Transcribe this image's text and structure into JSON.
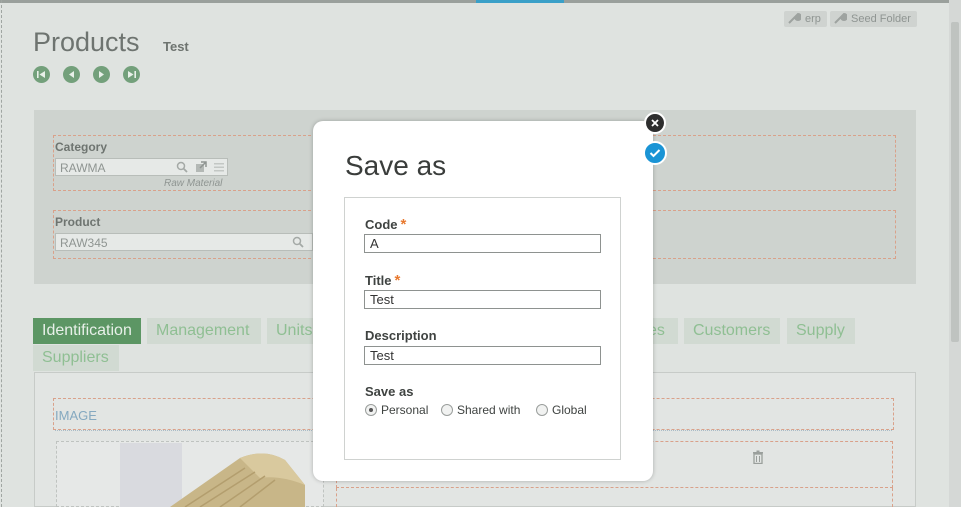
{
  "header": {
    "title": "Products",
    "subtitle": "Test",
    "erp_label": "erp",
    "seed_folder_label": "Seed Folder"
  },
  "form": {
    "category": {
      "label": "Category",
      "value": "RAWMA",
      "help": "Raw Material"
    },
    "product": {
      "label": "Product",
      "value": "RAW345"
    }
  },
  "tabs": {
    "identification": "Identification",
    "management": "Management",
    "units": "Units",
    "sales_partial": "es",
    "customers": "Customers",
    "supply": "Supply",
    "suppliers": "Suppliers"
  },
  "content": {
    "image_label": "IMAGE"
  },
  "modal": {
    "title": "Save as",
    "code_label": "Code",
    "code_value": "A",
    "title_label": "Title",
    "title_value": "Test",
    "description_label": "Description",
    "description_value": "Test",
    "save_as_label": "Save as",
    "options": [
      "Personal",
      "Shared with",
      "Global"
    ],
    "selected": "Personal",
    "required_mark": "*"
  },
  "colors": {
    "accent_blue": "#1a94d5",
    "tab_active": "#5c9664",
    "required": "#e8792f"
  }
}
